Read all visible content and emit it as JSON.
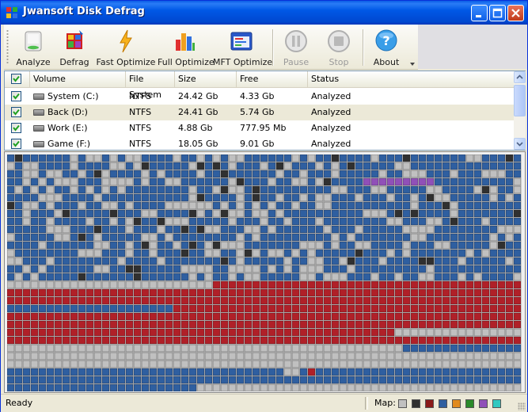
{
  "app": {
    "title": "Jwansoft Disk Defrag"
  },
  "toolbar": {
    "buttons": [
      {
        "label": "Analyze",
        "icon": "disk-analyze-icon",
        "enabled": true
      },
      {
        "label": "Defrag",
        "icon": "defrag-blocks-icon",
        "enabled": true
      },
      {
        "label": "Fast Optimize",
        "icon": "lightning-icon",
        "enabled": true
      },
      {
        "label": "Full Optimize",
        "icon": "bar-chart-icon",
        "enabled": true
      },
      {
        "label": "MFT Optimize",
        "icon": "mft-window-icon",
        "enabled": true
      },
      {
        "label": "Pause",
        "icon": "pause-icon",
        "enabled": false
      },
      {
        "label": "Stop",
        "icon": "stop-icon",
        "enabled": false
      },
      {
        "label": "About",
        "icon": "help-icon",
        "enabled": true
      }
    ]
  },
  "volumes": {
    "columns": [
      "Volume",
      "File System",
      "Size",
      "Free",
      "Status"
    ],
    "rows": [
      {
        "volume": "System (C:)",
        "fs": "NTFS",
        "size": "24.42 Gb",
        "free": "4.33 Gb",
        "status": "Analyzed",
        "checked": true,
        "selected": false
      },
      {
        "volume": "Back (D:)",
        "fs": "NTFS",
        "size": "24.41 Gb",
        "free": "5.74 Gb",
        "status": "Analyzed",
        "checked": true,
        "selected": true
      },
      {
        "volume": "Work (E:)",
        "fs": "NTFS",
        "size": "4.88 Gb",
        "free": "777.95 Mb",
        "status": "Analyzed",
        "checked": true,
        "selected": false
      },
      {
        "volume": "Game (F:)",
        "fs": "NTFS",
        "size": "18.05 Gb",
        "free": "9.01 Gb",
        "status": "Analyzed",
        "checked": true,
        "selected": false
      }
    ]
  },
  "status": {
    "text": "Ready",
    "map_label": "Map:"
  },
  "colors": {
    "free": "#c0c0c0",
    "fragmented": "#303030",
    "allocated": "#2f5fa0",
    "optimized": "#b02028",
    "mft": "#e08a1e",
    "reserved": "#2a8a2a",
    "system": "#9050b8",
    "unmovable": "#30c8c0"
  },
  "legend_colors": [
    "#c0c0c0",
    "#303030",
    "#8a1a1a",
    "#2f5fa0",
    "#e08a1e",
    "#2a8a2a",
    "#9050b8",
    "#30c8c0"
  ]
}
